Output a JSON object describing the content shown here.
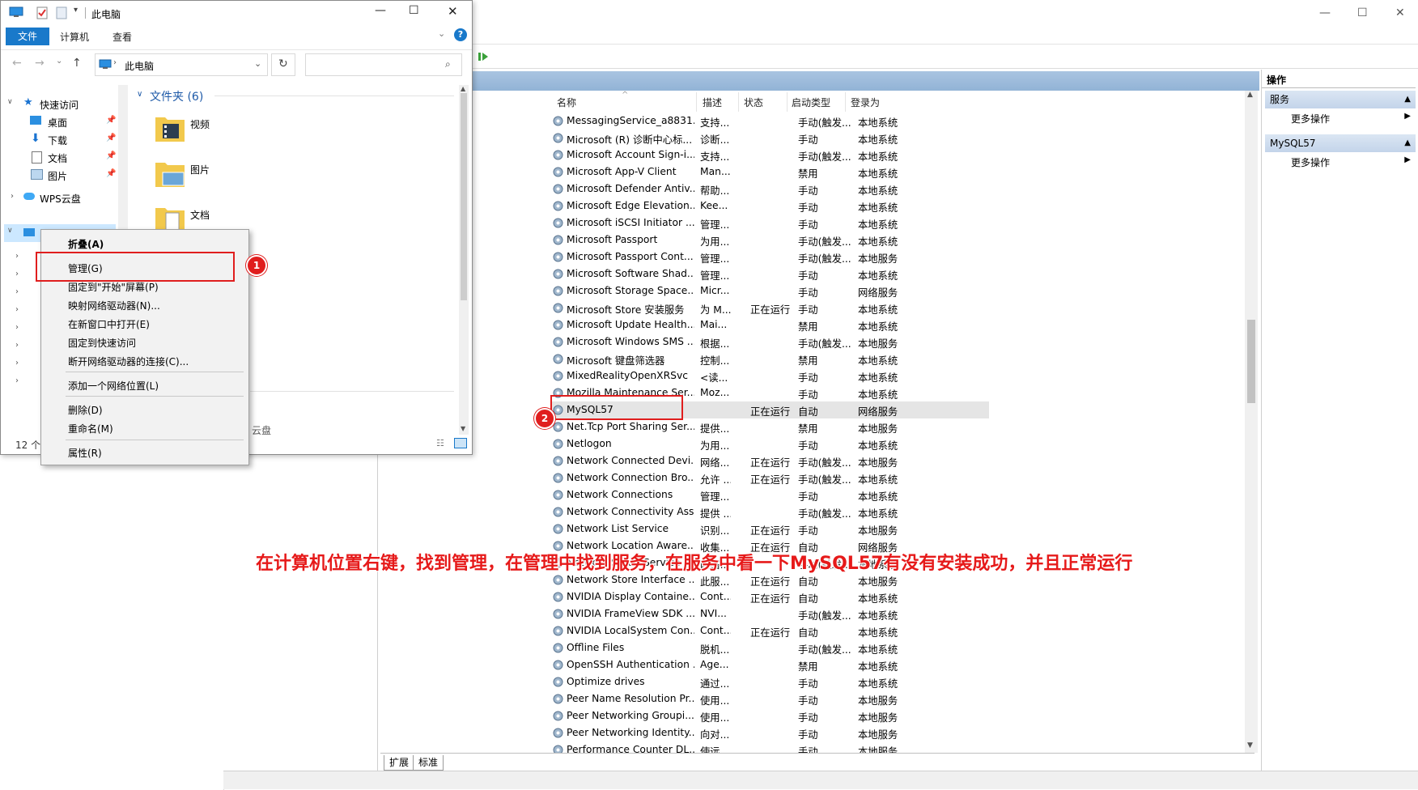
{
  "mmc": {
    "window_controls": [
      "—",
      "☐",
      "✕"
    ],
    "columns": {
      "name": "名称",
      "desc": "描述",
      "status": "状态",
      "startup": "启动类型",
      "logon": "登录为"
    },
    "services": [
      {
        "name": "MessagingService_a8831...",
        "desc": "支持...",
        "status": "",
        "startup": "手动(触发...",
        "logon": "本地系统"
      },
      {
        "name": "Microsoft (R) 诊断中心标...",
        "desc": "诊断...",
        "status": "",
        "startup": "手动",
        "logon": "本地系统"
      },
      {
        "name": "Microsoft Account Sign-i...",
        "desc": "支持...",
        "status": "",
        "startup": "手动(触发...",
        "logon": "本地系统"
      },
      {
        "name": "Microsoft App-V Client",
        "desc": "Man...",
        "status": "",
        "startup": "禁用",
        "logon": "本地系统"
      },
      {
        "name": "Microsoft Defender Antiv...",
        "desc": "帮助...",
        "status": "",
        "startup": "手动",
        "logon": "本地系统"
      },
      {
        "name": "Microsoft Edge Elevation...",
        "desc": "Kee...",
        "status": "",
        "startup": "手动",
        "logon": "本地系统"
      },
      {
        "name": "Microsoft iSCSI Initiator ...",
        "desc": "管理...",
        "status": "",
        "startup": "手动",
        "logon": "本地系统"
      },
      {
        "name": "Microsoft Passport",
        "desc": "为用...",
        "status": "",
        "startup": "手动(触发...",
        "logon": "本地系统"
      },
      {
        "name": "Microsoft Passport Cont...",
        "desc": "管理...",
        "status": "",
        "startup": "手动(触发...",
        "logon": "本地服务"
      },
      {
        "name": "Microsoft Software Shad...",
        "desc": "管理...",
        "status": "",
        "startup": "手动",
        "logon": "本地系统"
      },
      {
        "name": "Microsoft Storage Space...",
        "desc": "Micr...",
        "status": "",
        "startup": "手动",
        "logon": "网络服务"
      },
      {
        "name": "Microsoft Store 安装服务",
        "desc": "为 M...",
        "status": "正在运行",
        "startup": "手动",
        "logon": "本地系统"
      },
      {
        "name": "Microsoft Update Health...",
        "desc": "Mai...",
        "status": "",
        "startup": "禁用",
        "logon": "本地系统"
      },
      {
        "name": "Microsoft Windows SMS ...",
        "desc": "根据...",
        "status": "",
        "startup": "手动(触发...",
        "logon": "本地服务"
      },
      {
        "name": "Microsoft 键盘筛选器",
        "desc": "控制...",
        "status": "",
        "startup": "禁用",
        "logon": "本地系统"
      },
      {
        "name": "MixedRealityOpenXRSvc",
        "desc": "<读...",
        "status": "",
        "startup": "手动",
        "logon": "本地系统"
      },
      {
        "name": "Mozilla Maintenance Ser...",
        "desc": "Moz...",
        "status": "",
        "startup": "手动",
        "logon": "本地系统"
      },
      {
        "name": "MySQL57",
        "desc": "",
        "status": "正在运行",
        "startup": "自动",
        "logon": "网络服务"
      },
      {
        "name": "Net.Tcp Port Sharing Ser...",
        "desc": "提供...",
        "status": "",
        "startup": "禁用",
        "logon": "本地服务"
      },
      {
        "name": "Netlogon",
        "desc": "为用...",
        "status": "",
        "startup": "手动",
        "logon": "本地系统"
      },
      {
        "name": "Network Connected Devi...",
        "desc": "网络...",
        "status": "正在运行",
        "startup": "手动(触发...",
        "logon": "本地服务"
      },
      {
        "name": "Network Connection Bro...",
        "desc": "允许 ...",
        "status": "正在运行",
        "startup": "手动(触发...",
        "logon": "本地系统"
      },
      {
        "name": "Network Connections",
        "desc": "管理...",
        "status": "",
        "startup": "手动",
        "logon": "本地系统"
      },
      {
        "name": "Network Connectivity Ass...",
        "desc": "提供 ...",
        "status": "",
        "startup": "手动(触发...",
        "logon": "本地系统"
      },
      {
        "name": "Network List Service",
        "desc": "识别...",
        "status": "正在运行",
        "startup": "手动",
        "logon": "本地服务"
      },
      {
        "name": "Network Location Aware...",
        "desc": "收集...",
        "status": "正在运行",
        "startup": "自动",
        "logon": "网络服务"
      },
      {
        "name": "Network Setup Service",
        "desc": "网络...",
        "status": "",
        "startup": "手动(触发...",
        "logon": "本地系统"
      },
      {
        "name": "Network Store Interface ...",
        "desc": "此服...",
        "status": "正在运行",
        "startup": "自动",
        "logon": "本地服务"
      },
      {
        "name": "NVIDIA Display Containe...",
        "desc": "Cont...",
        "status": "正在运行",
        "startup": "自动",
        "logon": "本地系统"
      },
      {
        "name": "NVIDIA FrameView SDK ...",
        "desc": "NVI...",
        "status": "",
        "startup": "手动(触发...",
        "logon": "本地系统"
      },
      {
        "name": "NVIDIA LocalSystem Con...",
        "desc": "Cont...",
        "status": "正在运行",
        "startup": "自动",
        "logon": "本地系统"
      },
      {
        "name": "Offline Files",
        "desc": "脱机...",
        "status": "",
        "startup": "手动(触发...",
        "logon": "本地系统"
      },
      {
        "name": "OpenSSH Authentication ...",
        "desc": "Age...",
        "status": "",
        "startup": "禁用",
        "logon": "本地系统"
      },
      {
        "name": "Optimize drives",
        "desc": "通过...",
        "status": "",
        "startup": "手动",
        "logon": "本地系统"
      },
      {
        "name": "Peer Name Resolution Pr...",
        "desc": "使用...",
        "status": "",
        "startup": "手动",
        "logon": "本地服务"
      },
      {
        "name": "Peer Networking Groupi...",
        "desc": "使用...",
        "status": "",
        "startup": "手动",
        "logon": "本地服务"
      },
      {
        "name": "Peer Networking Identity...",
        "desc": "向对...",
        "status": "",
        "startup": "手动",
        "logon": "本地服务"
      },
      {
        "name": "Performance Counter DL...",
        "desc": "使远...",
        "status": "",
        "startup": "手动",
        "logon": "本地服务"
      }
    ],
    "tabs": [
      "扩展",
      "标准"
    ],
    "actions": {
      "title": "操作",
      "group1": "服务",
      "group1_item": "更多操作",
      "group2": "MySQL57",
      "group2_item": "更多操作"
    }
  },
  "explorer": {
    "title": "此电脑",
    "ribbon_tabs": [
      "文件",
      "计算机",
      "查看"
    ],
    "address": "此电脑",
    "nav": {
      "quick_access": "快速访问",
      "items": [
        "桌面",
        "下载",
        "文档",
        "图片"
      ],
      "wps": "WPS云盘"
    },
    "folders_header": "文件夹 (6)",
    "folders": [
      "视频",
      "图片",
      "文档"
    ],
    "partial_text": "云盘",
    "status_count": "12 个"
  },
  "context_menu": {
    "items": [
      "折叠(A)",
      "管理(G)",
      "固定到\"开始\"屏幕(P)",
      "映射网络驱动器(N)...",
      "在新窗口中打开(E)",
      "固定到快速访问",
      "断开网络驱动器的连接(C)...",
      "添加一个网络位置(L)",
      "删除(D)",
      "重命名(M)",
      "属性(R)"
    ]
  },
  "annotations": {
    "badge1": "1",
    "badge2": "2",
    "note": "在计算机位置右键，找到管理，在管理中找到服务，在服务中看一下MySQL57有没有安装成功，并且正常运行"
  },
  "colors": {
    "accent": "#1979ca",
    "annotation_red": "#e01e1e",
    "header_band": "#a9c4e1"
  }
}
